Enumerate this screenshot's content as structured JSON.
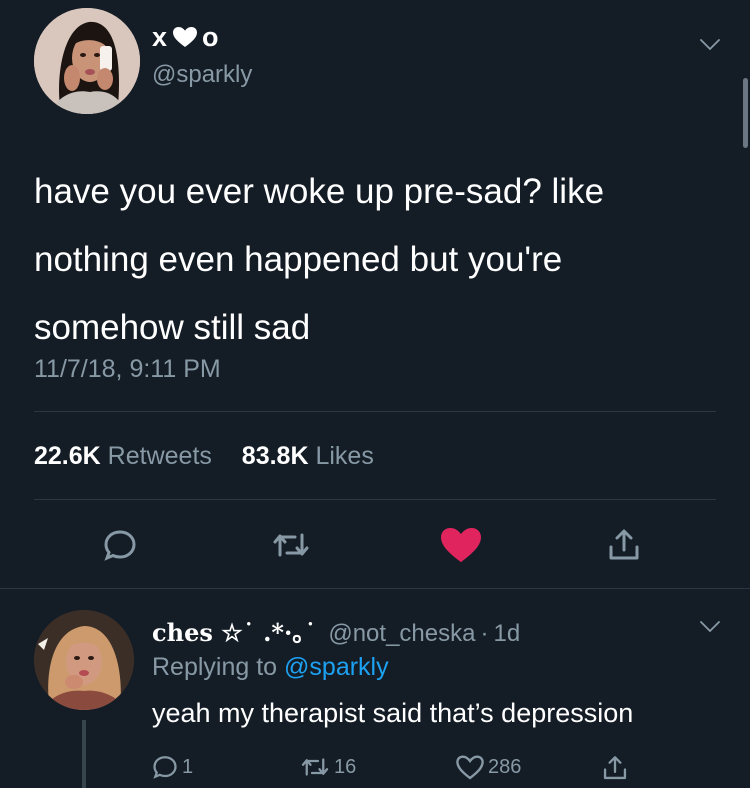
{
  "tweet": {
    "author": {
      "display_name": "x",
      "display_name_end": "o",
      "handle": "@sparkly",
      "avatar_icon": "profile-photo"
    },
    "text_lines": [
      "have you ever woke up pre-sad? like",
      "nothing even happened but you're",
      "somehow still sad"
    ],
    "timestamp": "11/7/18, 9:11 PM",
    "stats": {
      "retweets_count": "22.6K",
      "retweets_label": "Retweets",
      "likes_count": "83.8K",
      "likes_label": "Likes"
    },
    "actions": [
      {
        "name": "reply",
        "icon": "speech-bubble-icon"
      },
      {
        "name": "retweet",
        "icon": "retweet-icon"
      },
      {
        "name": "like",
        "icon": "heart-icon",
        "active": true
      },
      {
        "name": "share",
        "icon": "share-icon"
      }
    ]
  },
  "reply": {
    "author": {
      "display_name": "ches ☆˙ .*·｡˙",
      "handle": "@not_cheska",
      "separator": "·",
      "time": "1d"
    },
    "replying_prefix": "Replying to",
    "replying_to": "@sparkly",
    "text": "yeah my therapist said that’s depression",
    "actions": {
      "reply_count": "1",
      "retweet_count": "16",
      "like_count": "286"
    }
  },
  "colors": {
    "background": "#141d26",
    "primary_text": "#ffffff",
    "secondary_text": "#8899a6",
    "link": "#1da1f2",
    "like_active": "#e0245e",
    "divider": "#2b3742"
  }
}
